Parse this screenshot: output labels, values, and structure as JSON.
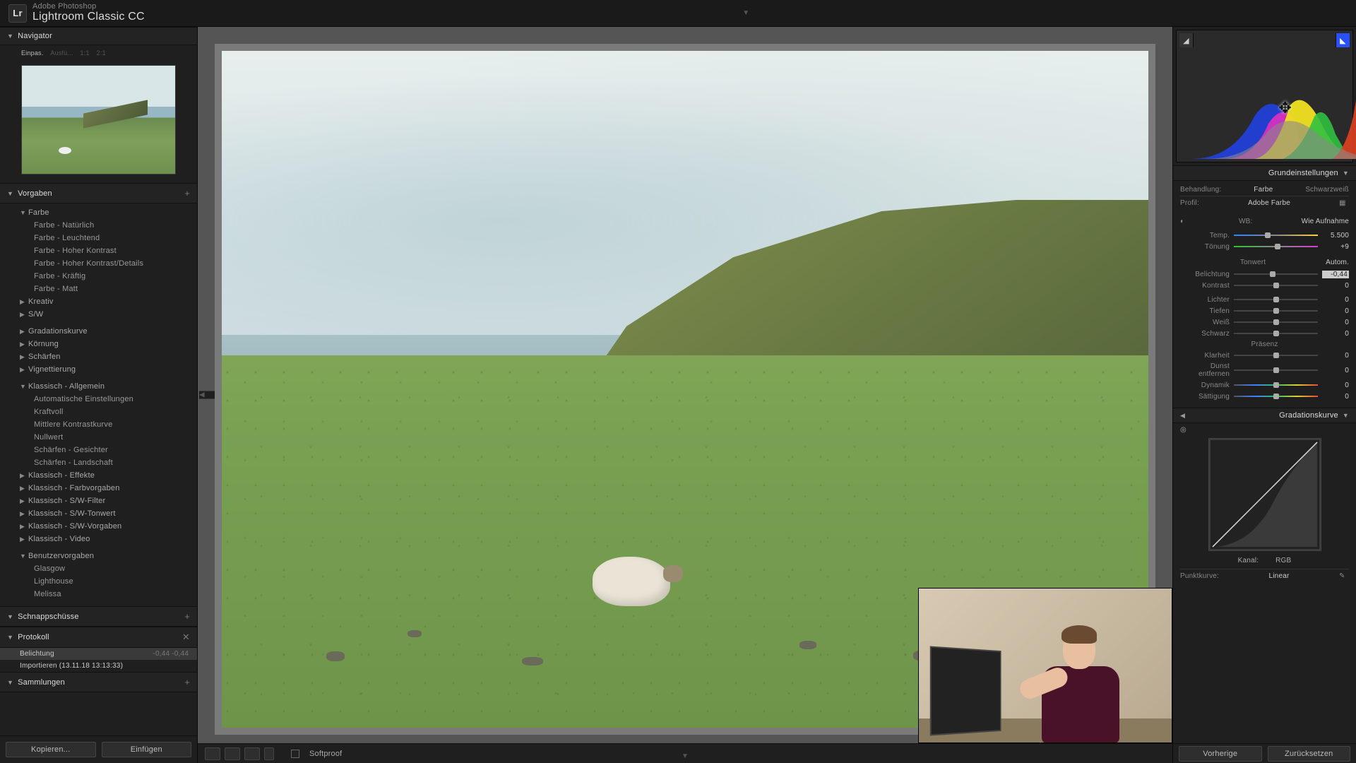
{
  "product": {
    "brand": "Adobe Photoshop",
    "name": "Lightroom Classic CC",
    "badge": "Lr"
  },
  "left": {
    "navigator": {
      "title": "Navigator",
      "opts": [
        "Einpas.",
        "Ausfü...",
        "1:1",
        "2:1"
      ]
    },
    "presets": {
      "title": "Vorgaben",
      "groups": [
        {
          "label": "Farbe",
          "items": [
            "Farbe - Natürlich",
            "Farbe - Leuchtend",
            "Farbe - Hoher Kontrast",
            "Farbe - Hoher Kontrast/Details",
            "Farbe - Kräftig",
            "Farbe - Matt"
          ]
        },
        {
          "label": "Kreativ"
        },
        {
          "label": "S/W"
        }
      ],
      "flat": [
        "Gradationskurve",
        "Körnung",
        "Schärfen",
        "Vignettierung"
      ],
      "classic_allg": {
        "label": "Klassisch - Allgemein",
        "items": [
          "Automatische Einstellungen",
          "Kraftvoll",
          "Mittlere Kontrastkurve",
          "Nullwert",
          "Schärfen - Gesichter",
          "Schärfen - Landschaft"
        ]
      },
      "classic_more": [
        "Klassisch - Effekte",
        "Klassisch - Farbvorgaben",
        "Klassisch - S/W-Filter",
        "Klassisch - S/W-Tonwert",
        "Klassisch - S/W-Vorgaben",
        "Klassisch - Video"
      ],
      "user": {
        "label": "Benutzervorgaben",
        "items": [
          "Glasgow",
          "Lighthouse",
          "Melissa"
        ]
      }
    },
    "snapshots": {
      "title": "Schnappschüsse"
    },
    "history": {
      "title": "Protokoll",
      "rows": [
        {
          "label": "Belichtung",
          "vals": "-0,44   -0,44"
        },
        {
          "label": "Importieren (13.11.18 13:13:33)",
          "vals": ""
        }
      ]
    },
    "collections": {
      "title": "Sammlungen"
    },
    "buttons": {
      "copy": "Kopieren...",
      "paste": "Einfügen"
    }
  },
  "toolbar": {
    "softproof": "Softproof"
  },
  "right": {
    "basic": {
      "title": "Grundeinstellungen",
      "treatment": {
        "label": "Behandlung:",
        "color": "Farbe",
        "bw": "Schwarzweiß"
      },
      "profile": {
        "label": "Profil:",
        "value": "Adobe Farbe"
      },
      "wb": {
        "label": "WB:",
        "value": "Wie Aufnahme",
        "temp": {
          "label": "Temp.",
          "value": "5.500"
        },
        "tint": {
          "label": "Tönung",
          "value": "+9"
        }
      },
      "tone": {
        "header": "Tonwert",
        "autom": "Autom.",
        "rows": [
          {
            "label": "Belichtung",
            "value": "-0,44"
          },
          {
            "label": "Kontrast",
            "value": "0"
          },
          {
            "label": "Lichter",
            "value": "0"
          },
          {
            "label": "Tiefen",
            "value": "0"
          },
          {
            "label": "Weiß",
            "value": "0"
          },
          {
            "label": "Schwarz",
            "value": "0"
          }
        ]
      },
      "presence": {
        "header": "Präsenz",
        "rows": [
          {
            "label": "Klarheit",
            "value": "0"
          },
          {
            "label": "Dunst entfernen",
            "value": "0"
          },
          {
            "label": "Dynamik",
            "value": "0"
          },
          {
            "label": "Sättigung",
            "value": "0"
          }
        ]
      }
    },
    "curve": {
      "title": "Gradationskurve",
      "kanal": "Kanal:",
      "rgb": "RGB",
      "pt": {
        "label": "Punktkurve:",
        "value": "Linear"
      }
    },
    "buttons": {
      "prev": "Vorherige",
      "reset": "Zurücksetzen"
    }
  }
}
